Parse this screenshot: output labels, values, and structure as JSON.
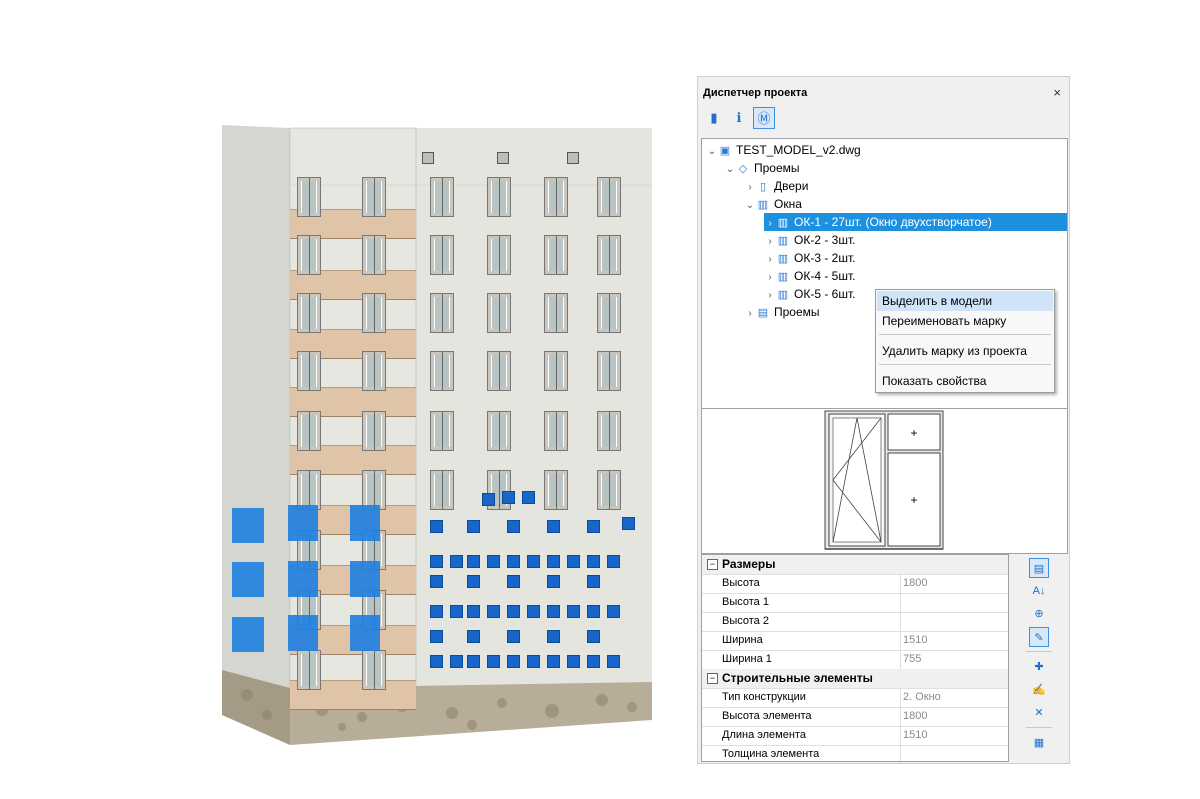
{
  "panel": {
    "title": "Диспетчер проекта",
    "close_glyph": "×",
    "toolbar": [
      "doors-icon",
      "info-icon",
      "model-icon"
    ]
  },
  "tree": {
    "root": "TEST_MODEL_v2.dwg",
    "group": "Проемы",
    "doors": "Двери",
    "windows": "Окна",
    "items": [
      "ОК-1 - 27шт. (Окно двухстворчатое)",
      "ОК-2 - 3шт.",
      "ОК-3 - 2шт.",
      "ОК-4 - 5шт.",
      "ОК-5 - 6шт."
    ],
    "openings": "Проемы"
  },
  "context_menu": {
    "select_in_model": "Выделить в модели",
    "rename_mark": "Переименовать марку",
    "delete_mark": "Удалить марку из проекта",
    "show_properties": "Показать свойства"
  },
  "properties": {
    "group1": "Размеры",
    "rows1": [
      {
        "k": "Высота",
        "v": "1800"
      },
      {
        "k": "Высота 1",
        "v": ""
      },
      {
        "k": "Высота 2",
        "v": ""
      },
      {
        "k": "Ширина",
        "v": "1510"
      },
      {
        "k": "Ширина 1",
        "v": "755"
      }
    ],
    "group2": "Строительные элементы",
    "rows2": [
      {
        "k": "Тип конструкции",
        "v": "2. Окно"
      },
      {
        "k": "Высота элемента",
        "v": "1800"
      },
      {
        "k": "Длина элемента",
        "v": "1510"
      },
      {
        "k": "Толщина элемента",
        "v": ""
      }
    ]
  },
  "colors": {
    "selection": "#1e7fe0",
    "highlight": "#1e90e0"
  }
}
